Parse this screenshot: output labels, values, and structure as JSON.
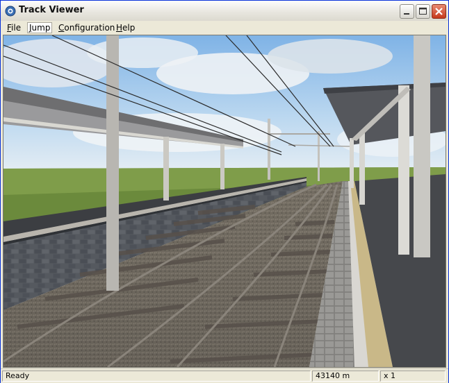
{
  "window": {
    "title": "Track Viewer"
  },
  "menubar": {
    "items": [
      "File",
      "Jump",
      "Configuration",
      "Help"
    ]
  },
  "statusbar": {
    "status": "Ready",
    "distance": "43140 m",
    "speed": "x 1"
  }
}
